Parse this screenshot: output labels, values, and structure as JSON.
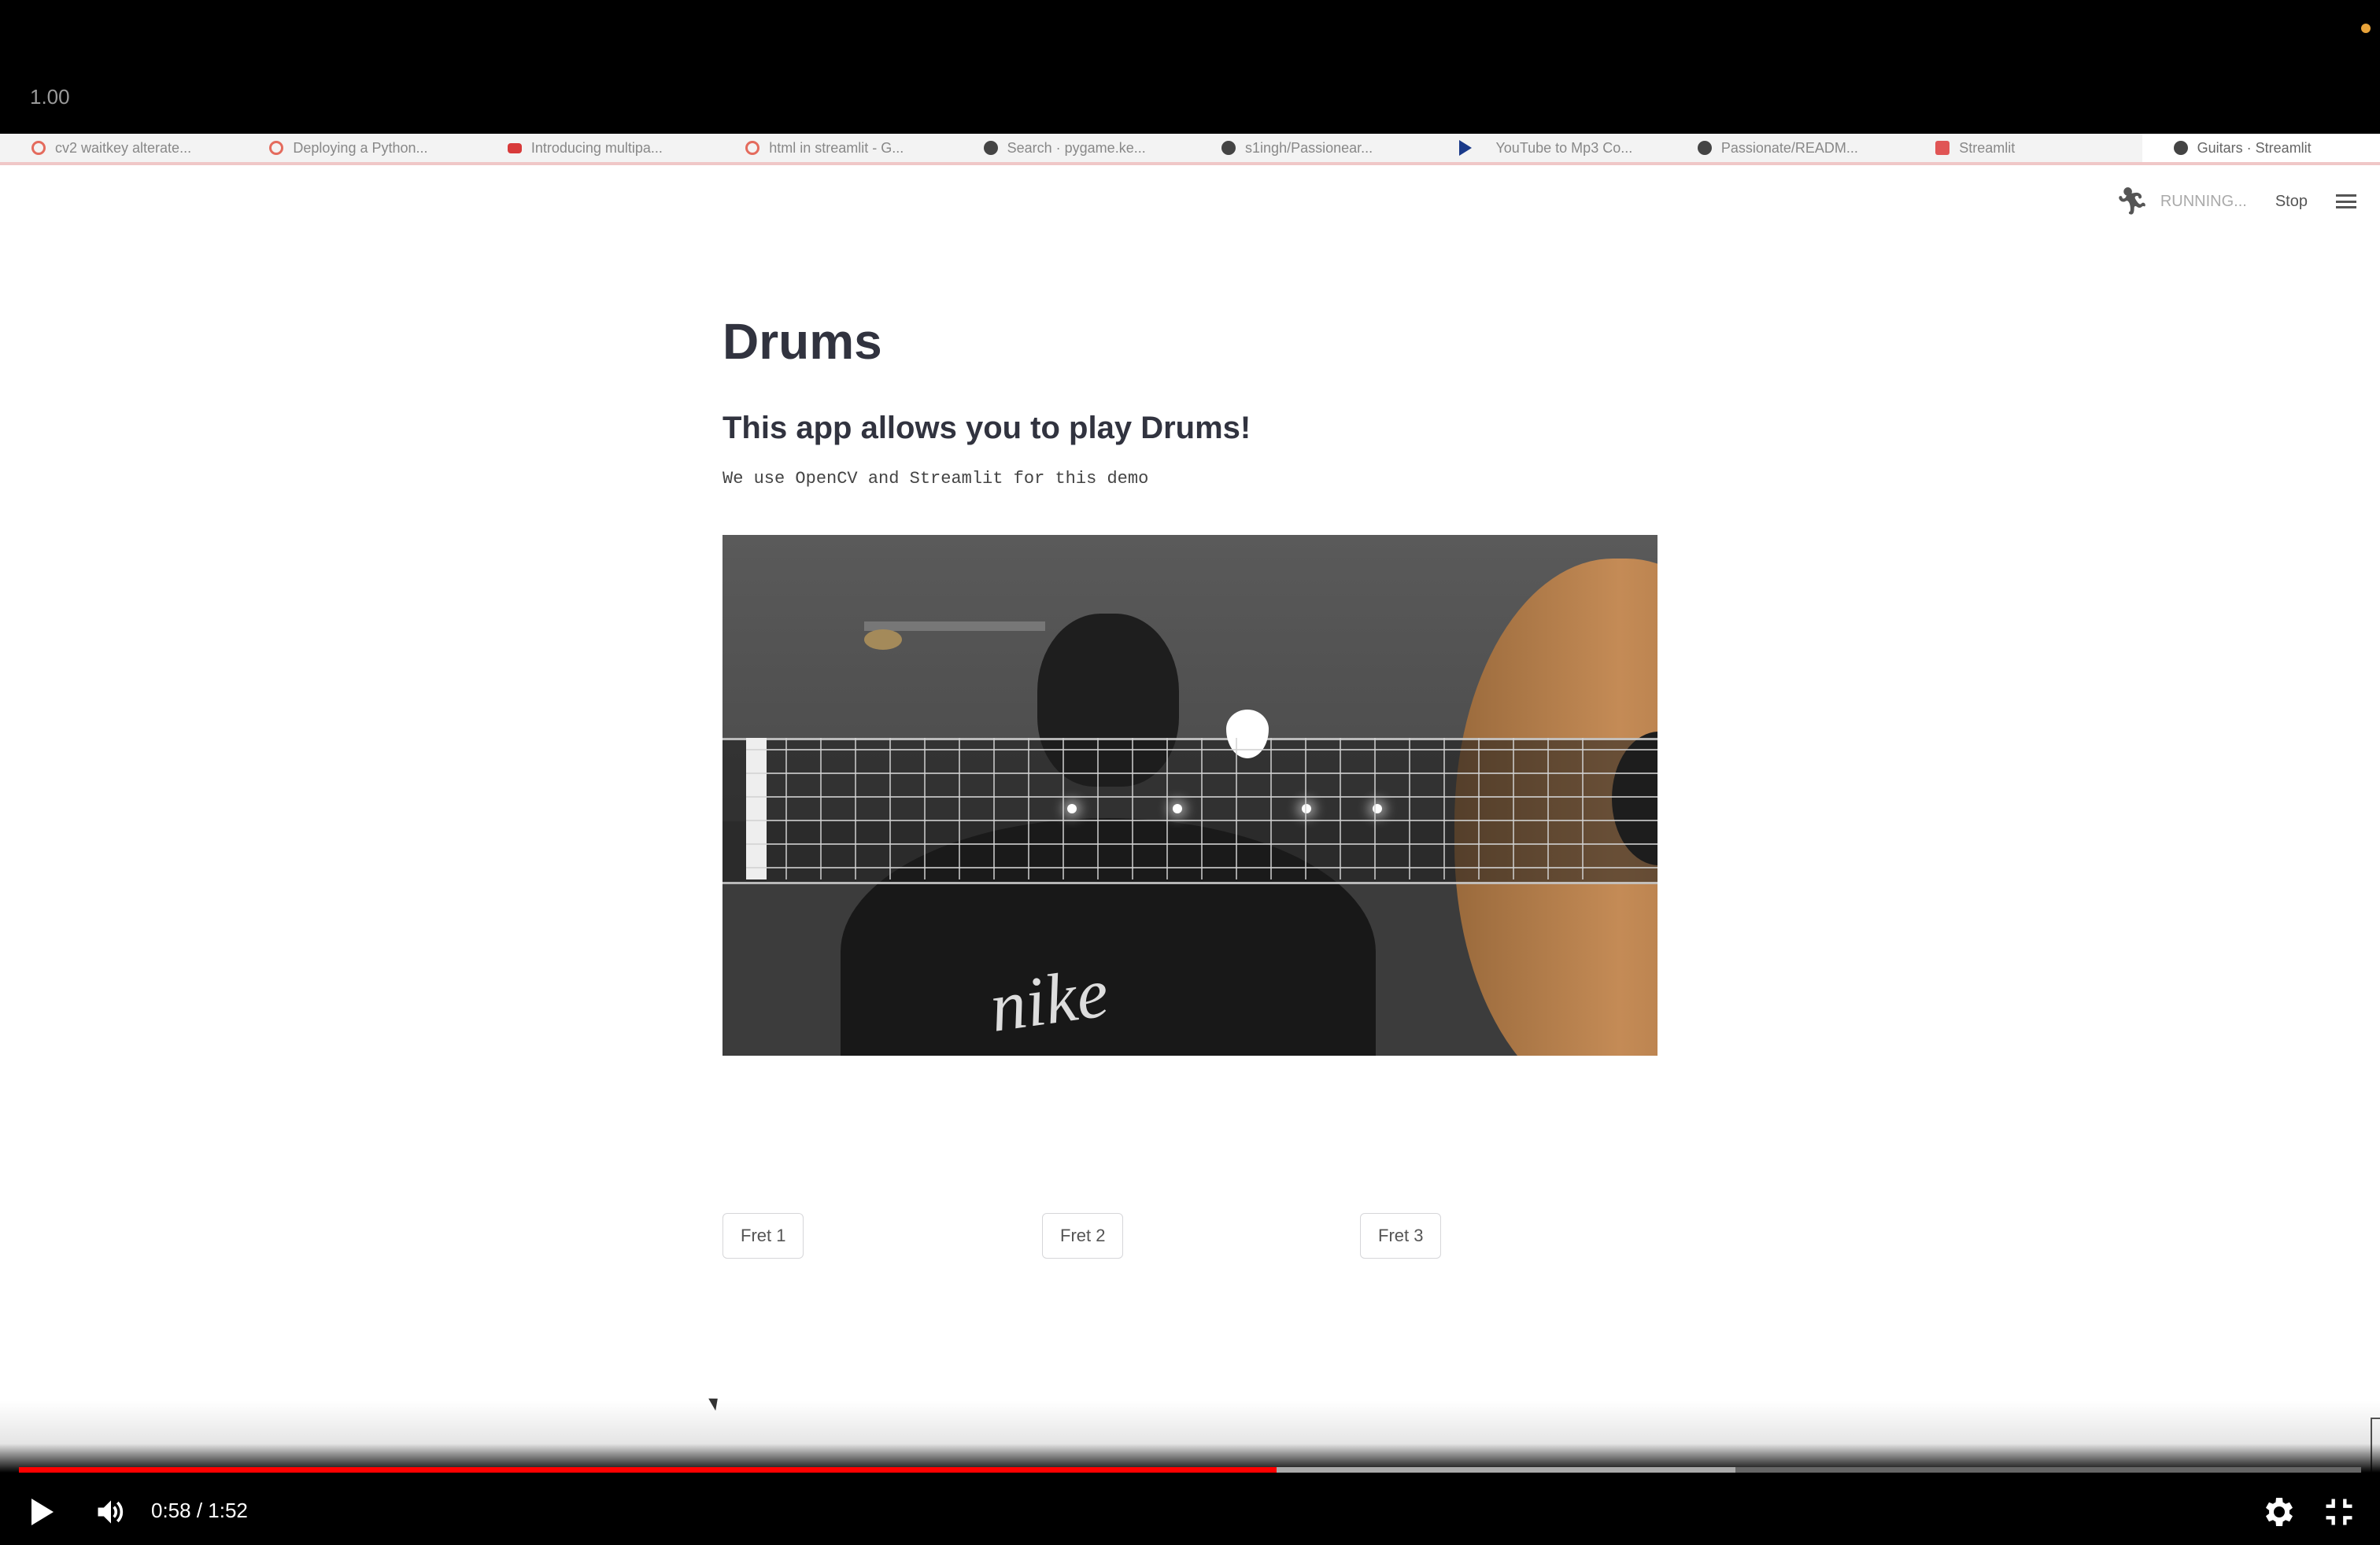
{
  "player": {
    "speed": "1.00",
    "time_display": "0:58 / 1:52",
    "progress_played": 0.5368,
    "progress_buffered": 0.733
  },
  "browser": {
    "tabs": [
      {
        "label": "cv2 waitkey alterate...",
        "icon": "chrome-icon"
      },
      {
        "label": "Deploying a Python...",
        "icon": "cloud-icon"
      },
      {
        "label": "Introducing multipa...",
        "icon": "youtube-icon"
      },
      {
        "label": "html in streamlit - G...",
        "icon": "chrome-icon"
      },
      {
        "label": "Search · pygame.ke...",
        "icon": "github-icon"
      },
      {
        "label": "s1ingh/Passionear...",
        "icon": "github-icon"
      },
      {
        "label": "YouTube to Mp3 Co...",
        "icon": "play-icon"
      },
      {
        "label": "Passionate/READM...",
        "icon": "github-icon"
      },
      {
        "label": "Streamlit",
        "icon": "streamlit-icon"
      },
      {
        "label": "Guitars · Streamlit",
        "icon": "github-icon",
        "active": true
      }
    ]
  },
  "streamlit": {
    "status": "RUNNING...",
    "stop": "Stop"
  },
  "app": {
    "title": "Drums",
    "subtitle": "This app allows you to play Drums!",
    "description": "We use OpenCV and Streamlit for this demo",
    "shirt_text": "nike",
    "buttons": [
      "Fret 1",
      "Fret 2",
      "Fret 3"
    ]
  },
  "colors": {
    "progress": "#ff0000",
    "accent_dot": "#e8a33a"
  }
}
